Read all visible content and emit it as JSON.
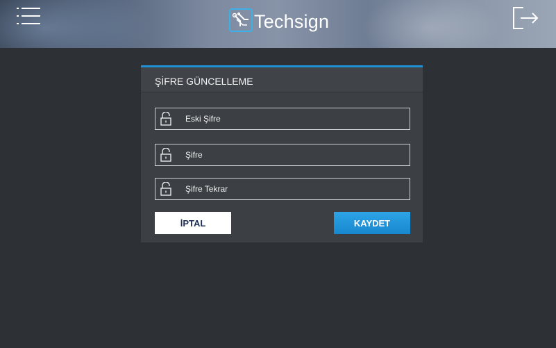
{
  "header": {
    "logo_text": "Techsign",
    "icons": {
      "menu": "hamburger-menu-icon",
      "logout": "logout-icon",
      "logo": "techsign-logo-icon"
    }
  },
  "form": {
    "title": "ŞİFRE GÜNCELLEME",
    "fields": [
      {
        "label": "Eski Şifre",
        "icon": "lock-icon"
      },
      {
        "label": "Şifre",
        "icon": "lock-icon"
      },
      {
        "label": "Şifre Tekrar",
        "icon": "lock-icon"
      }
    ],
    "cancel_label": "İPTAL",
    "save_label": "KAYDET"
  },
  "colors": {
    "background": "#2d3136",
    "panel": "#3c4045",
    "accent": "#1f8fd6",
    "save_button": "#1e95dc",
    "cancel_text": "#1f2f55"
  }
}
